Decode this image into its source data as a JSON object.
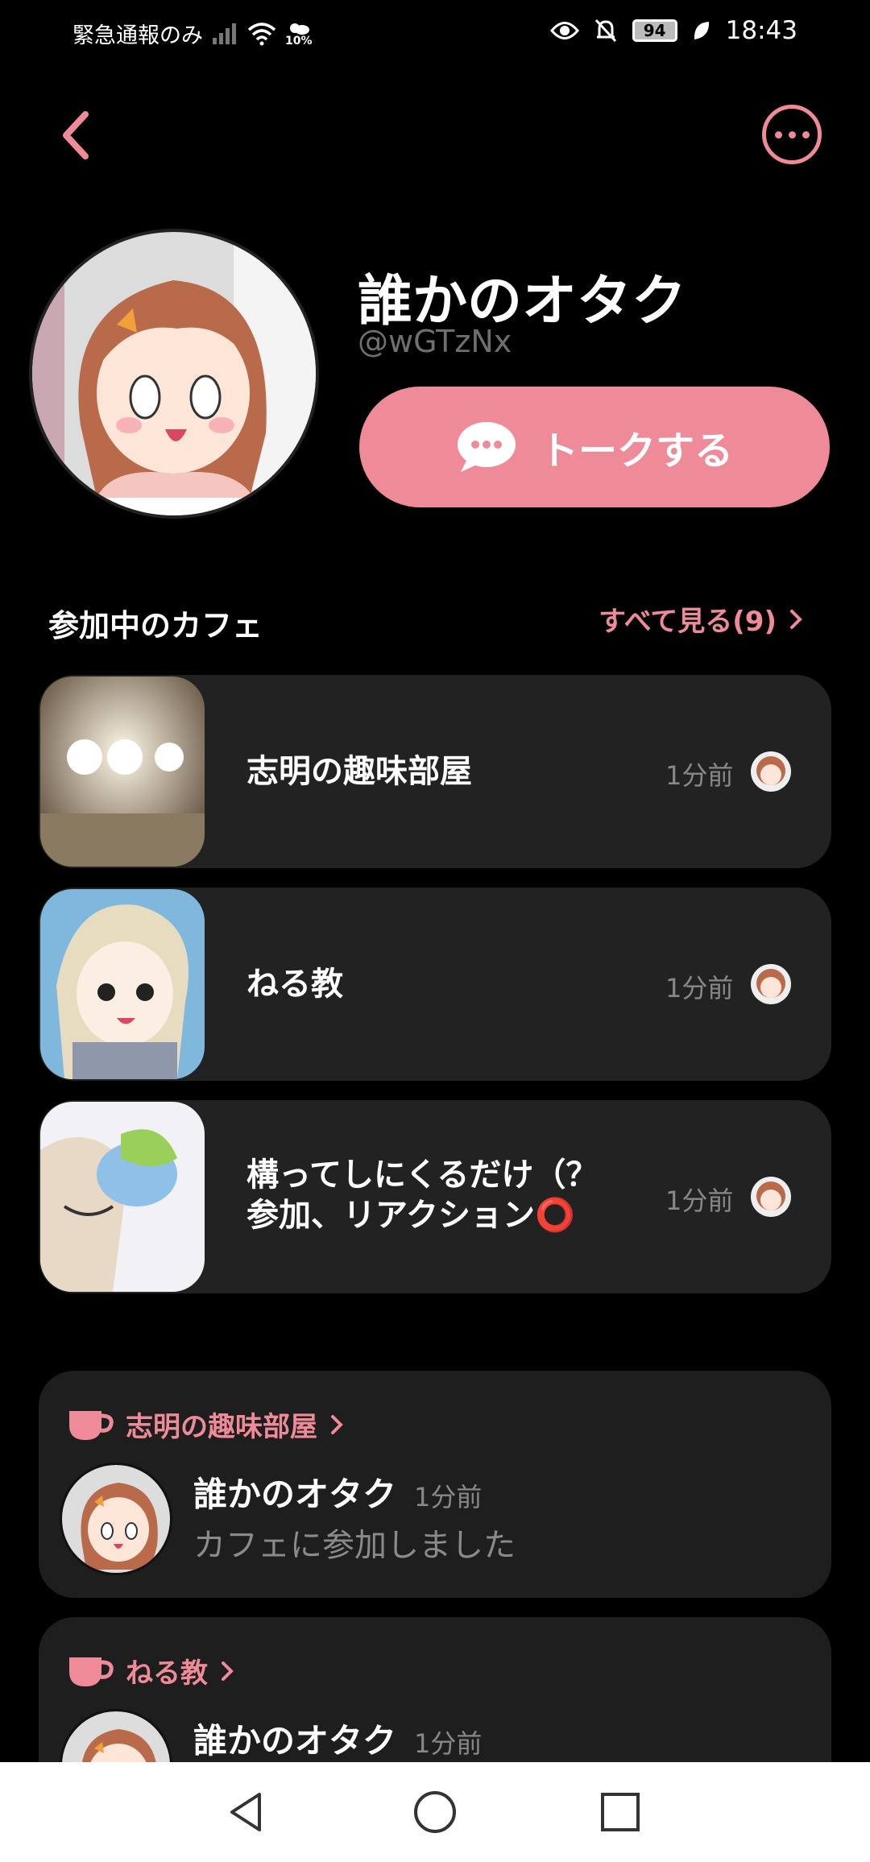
{
  "status_bar": {
    "carrier": "緊急通報のみ",
    "weather_pct": "10%",
    "battery": "94",
    "time": "18:43"
  },
  "profile": {
    "name": "誰かのオタク",
    "handle": "@wGTzNx",
    "talk_label": "トークする"
  },
  "cafes_section": {
    "title": "参加中のカフェ",
    "see_all": "すべて見る(9)",
    "items": [
      {
        "name": "志明の趣味部屋",
        "time": "1分前"
      },
      {
        "name": "ねる教",
        "time": "1分前"
      },
      {
        "name": "構ってしにくるだけ（？\n参加、リアクション⭕",
        "time": "1分前"
      }
    ]
  },
  "activity": [
    {
      "cafe": "志明の趣味部屋",
      "user": "誰かのオタク",
      "time": "1分前",
      "text": "カフェに参加しました"
    },
    {
      "cafe": "ねる教",
      "user": "誰かのオタク",
      "time": "1分前",
      "text": ""
    }
  ],
  "colors": {
    "accent": "#ef8a98",
    "card": "#222222",
    "background": "#000000"
  },
  "icons": [
    "back-icon",
    "more-icon",
    "chat-bubble-icon",
    "chevron-right-icon",
    "cup-icon",
    "nav-back-icon",
    "nav-home-icon",
    "nav-recents-icon"
  ]
}
